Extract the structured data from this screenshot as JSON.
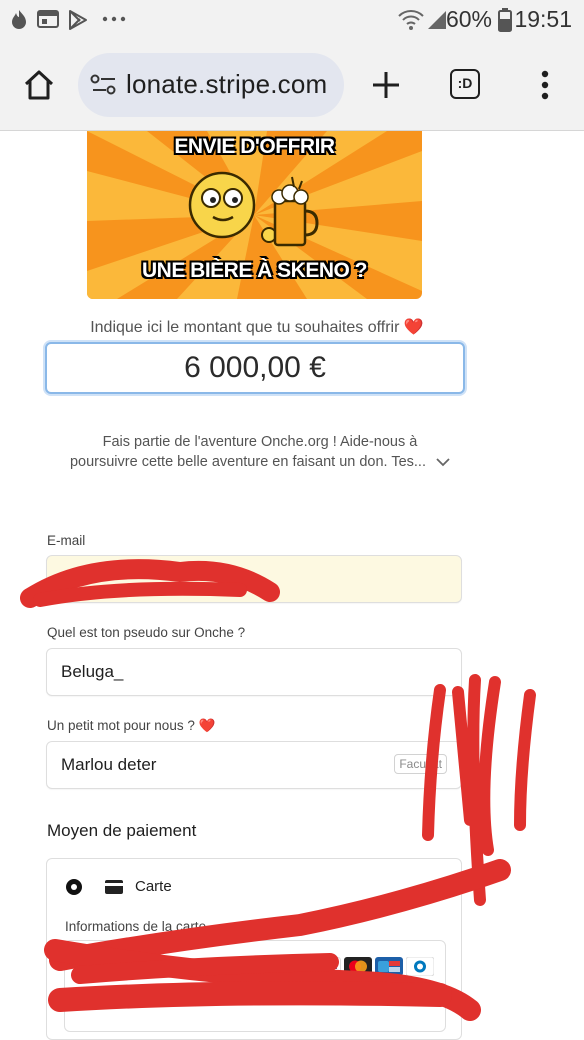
{
  "status_bar": {
    "battery_percent": "60%",
    "time": "19:51"
  },
  "browser": {
    "url": "lonate.stripe.com",
    "tabs_label": ":D"
  },
  "banner": {
    "top_text": "ENVIE D'OFFRIR",
    "bottom_text": "UNE BIÈRE À SKENO ?"
  },
  "donation": {
    "amount_label": "Indique ici le montant que tu souhaites offrir ❤️",
    "amount_value": "6 000,00 €",
    "description_line1": "Fais partie de l'aventure Onche.org ! Aide-nous à",
    "description_line2": "poursuivre cette belle aventure en faisant un don. Tes..."
  },
  "form": {
    "email_label": "E-mail",
    "pseudo_label": "Quel est ton pseudo sur Onche ?",
    "pseudo_value": "Beluga_",
    "message_label": "Un petit mot pour nous ? ❤️",
    "message_value": "Marlou deter",
    "optional_tag": "Facultat",
    "payment_title": "Moyen de paiement",
    "card_option_label": "Carte",
    "card_info_label": "Informations de la carte",
    "card_brands": [
      "VISA",
      "Mastercard",
      "Cartes Bancaires",
      "Diners Club"
    ]
  },
  "colors": {
    "accent_focus": "#8ab8e8",
    "autofill_bg": "#fdf9e1",
    "scribble_red": "#e0312d",
    "banner_orange": "#f7941d"
  }
}
